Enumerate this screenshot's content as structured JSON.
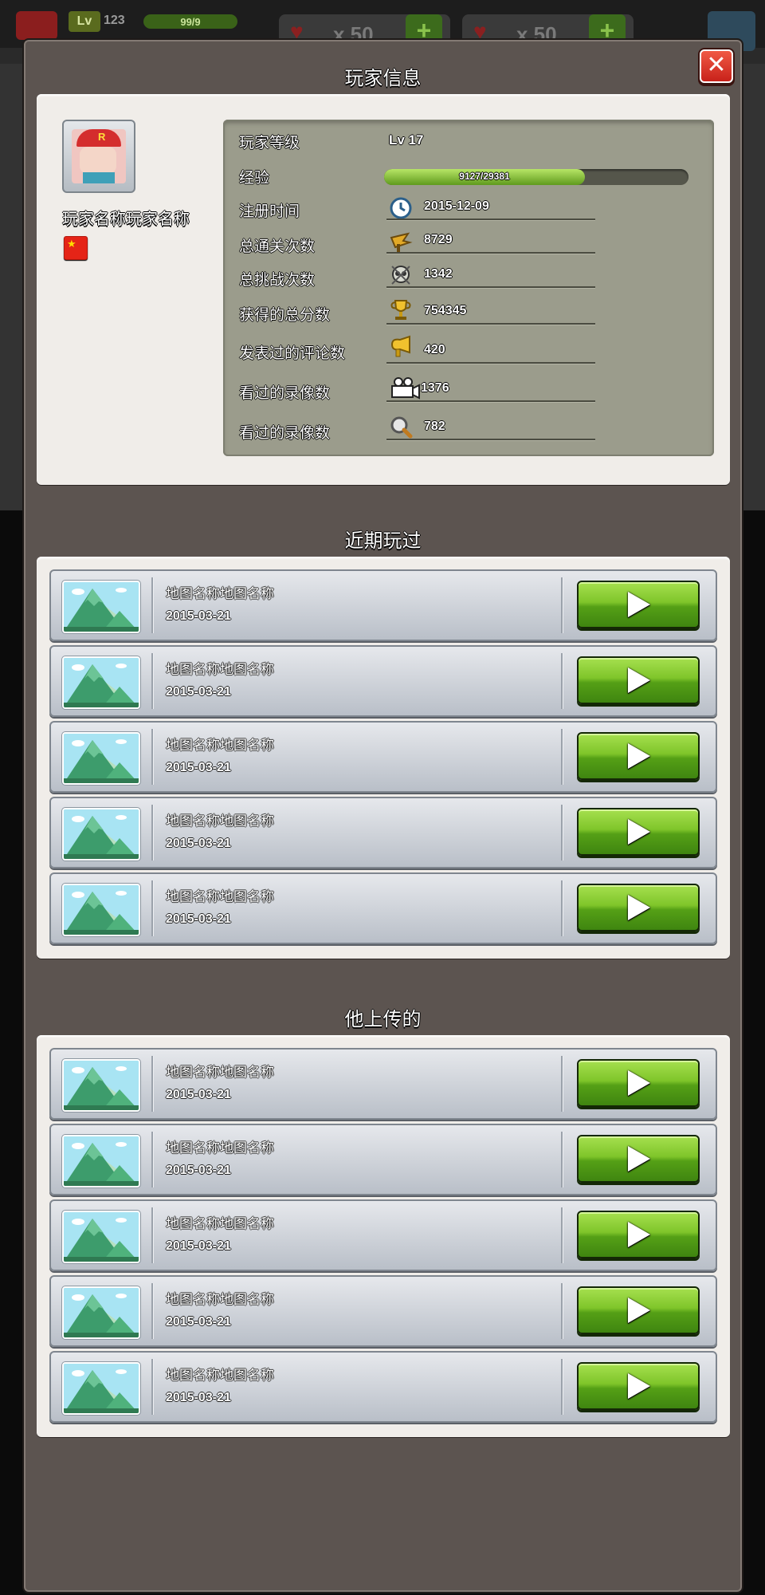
{
  "hud": {
    "level_badge": "Lv",
    "level": "123",
    "exp": "99/9",
    "resources": [
      {
        "amount": "x 50",
        "icon": "heart-icon"
      },
      {
        "amount": "x 50",
        "icon": "heart-icon"
      }
    ],
    "plus_label": "+"
  },
  "dialog": {
    "close_label": "✕",
    "player_info_title": "玩家信息",
    "recent_title": "近期玩过",
    "uploaded_title": "他上传的"
  },
  "player": {
    "name": "玩家名称玩家名称",
    "avatar_letter": "R",
    "flag_star": "★",
    "level_label": "玩家等级",
    "level_value": "Lv 17",
    "exp_label": "经验",
    "exp_text": "9127/29381",
    "exp_current": 9127,
    "exp_max": 29381,
    "stats": [
      {
        "label": "注册时间",
        "value": "2015-12-09",
        "icon": "clock-icon"
      },
      {
        "label": "总通关次数",
        "value": "8729",
        "icon": "flag-icon"
      },
      {
        "label": "总挑战次数",
        "value": "1342",
        "icon": "skull-icon"
      },
      {
        "label": "获得的总分数",
        "value": "754345",
        "icon": "trophy-icon"
      },
      {
        "label": "发表过的评论数",
        "value": "420",
        "icon": "horn-icon"
      },
      {
        "label": "看过的录像数",
        "value": "1376",
        "icon": "camera-icon"
      },
      {
        "label": "看过的录像数",
        "value": "782",
        "icon": "magnifier-icon"
      }
    ]
  },
  "recent_maps": [
    {
      "name": "地图名称地图名称",
      "date": "2015-03-21"
    },
    {
      "name": "地图名称地图名称",
      "date": "2015-03-21"
    },
    {
      "name": "地图名称地图名称",
      "date": "2015-03-21"
    },
    {
      "name": "地图名称地图名称",
      "date": "2015-03-21"
    },
    {
      "name": "地图名称地图名称",
      "date": "2015-03-21"
    }
  ],
  "uploaded_maps": [
    {
      "name": "地图名称地图名称",
      "date": "2015-03-21"
    },
    {
      "name": "地图名称地图名称",
      "date": "2015-03-21"
    },
    {
      "name": "地图名称地图名称",
      "date": "2015-03-21"
    },
    {
      "name": "地图名称地图名称",
      "date": "2015-03-21"
    },
    {
      "name": "地图名称地图名称",
      "date": "2015-03-21"
    }
  ],
  "colors": {
    "dialog_bg": "#5c5450",
    "panel_bg": "#f0ede9",
    "stats_bg": "#9b9c8c",
    "play_green": "#6fb824",
    "close_red": "#d8332a"
  }
}
